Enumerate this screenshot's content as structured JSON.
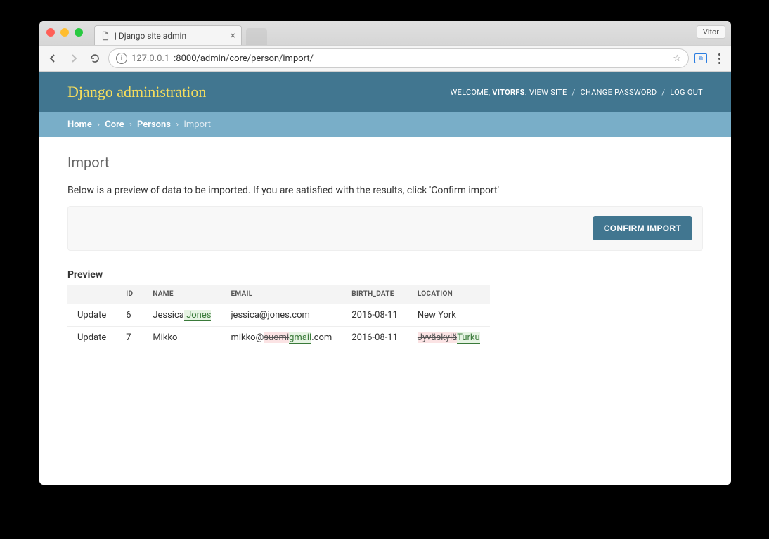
{
  "browser": {
    "profile_name": "Vitor",
    "tab_title": "| Django site admin",
    "url_host": "127.0.0.1",
    "url_path": ":8000/admin/core/person/import/"
  },
  "header": {
    "site_title": "Django administration",
    "welcome_label": "WELCOME,",
    "username": "VITORFS",
    "view_site": "VIEW SITE",
    "change_password": "CHANGE PASSWORD",
    "logout": "LOG OUT"
  },
  "breadcrumbs": {
    "home": "Home",
    "app": "Core",
    "model": "Persons",
    "current": "Import"
  },
  "content": {
    "title": "Import",
    "description": "Below is a preview of data to be imported. If you are satisfied with the results, click 'Confirm import'",
    "confirm_button": "CONFIRM IMPORT",
    "preview_heading": "Preview"
  },
  "table": {
    "header_action": "",
    "columns": [
      "ID",
      "NAME",
      "EMAIL",
      "BIRTH_DATE",
      "LOCATION"
    ],
    "rows": [
      {
        "action": "Update",
        "id": "6",
        "name_old": "Jessica",
        "name_new": " Jones",
        "email_plain": "jessica@jones.com",
        "birth_date": "2016-08-11",
        "location_plain": "New York"
      },
      {
        "action": "Update",
        "id": "7",
        "name_plain": "Mikko",
        "email_pre": "mikko@",
        "email_del": "suomi",
        "email_ins": "gmail",
        "email_post": ".com",
        "birth_date": "2016-08-11",
        "location_del": "Jyväskylä",
        "location_ins": "Turku"
      }
    ]
  }
}
